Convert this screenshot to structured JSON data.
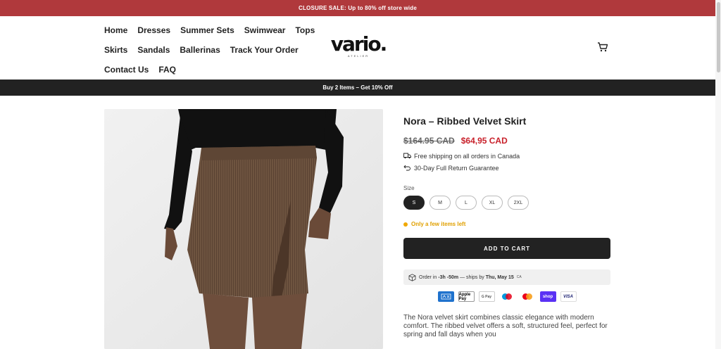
{
  "announcement": "CLOSURE SALE: Up to 80% off store wide",
  "nav": {
    "row1": [
      "Home",
      "Dresses",
      "Summer Sets",
      "Swimwear",
      "Tops"
    ],
    "row2": [
      "Skirts",
      "Sandals",
      "Ballerinas",
      "Track Your Order"
    ],
    "row3": [
      "Contact Us",
      "FAQ"
    ]
  },
  "logo": {
    "main": "vario.",
    "sub": "ATELIER"
  },
  "promo": "Buy 2 Items – Get 10% Off",
  "product": {
    "title": "Nora – Ribbed Velvet Skirt",
    "price_old": "$164.95 CAD",
    "price_new": "$64,95 CAD",
    "perks": [
      "Free shipping on all orders in Canada",
      "30-Day Full Return Guarantee"
    ],
    "size_label": "Size",
    "sizes": [
      "S",
      "M",
      "L",
      "XL",
      "2XL"
    ],
    "selected_size": "S",
    "stock": "Only a few items left",
    "add_to_cart": "ADD TO CART",
    "shipping": {
      "prefix": "Order in",
      "countdown": "-3h -50m",
      "middle": "— ships by",
      "date": "Thu, May 15",
      "tz": "CA"
    },
    "payments": [
      "AMEX",
      "Apple Pay",
      "G Pay",
      "Maestro",
      "Mastercard",
      "shop",
      "VISA"
    ],
    "description": "The Nora velvet skirt combines classic elegance with modern comfort. The ribbed velvet offers a soft, structured feel, perfect for spring and fall days when you"
  },
  "colors": {
    "announce_bg": "#b0393c",
    "promo_bg": "#222222",
    "sale_price": "#c8202a",
    "stock": "#f0a800"
  }
}
